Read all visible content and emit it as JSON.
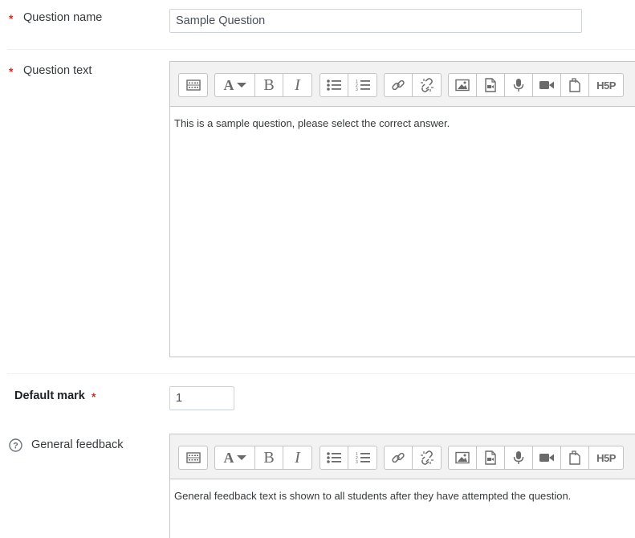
{
  "question_name": {
    "required_mark": "*",
    "label": "Question name",
    "value": "Sample Question"
  },
  "question_text": {
    "required_mark": "*",
    "label": "Question text",
    "content": "This is a sample question, please select the correct answer."
  },
  "default_mark": {
    "label": "Default mark",
    "required_mark": "*",
    "value": "1"
  },
  "general_feedback": {
    "label": "General feedback",
    "content": "General feedback text is shown to all students after they have attempted the question."
  },
  "toolbar": {
    "bold_glyph": "B",
    "italic_glyph": "I",
    "font_glyph": "A",
    "h5p_label": "H5P",
    "icons": [
      "show-more-buttons-icon",
      "font-style-icon",
      "bold-icon",
      "italic-icon",
      "unordered-list-icon",
      "ordered-list-icon",
      "link-icon",
      "unlink-icon",
      "image-icon",
      "media-icon",
      "record-audio-icon",
      "record-video-icon",
      "manage-files-icon",
      "h5p-icon"
    ]
  },
  "colors": {
    "required": "#ca3120",
    "toolbar_bg": "#f2f2f2",
    "border": "#c6c6c6",
    "icon": "#6a6a6a"
  }
}
